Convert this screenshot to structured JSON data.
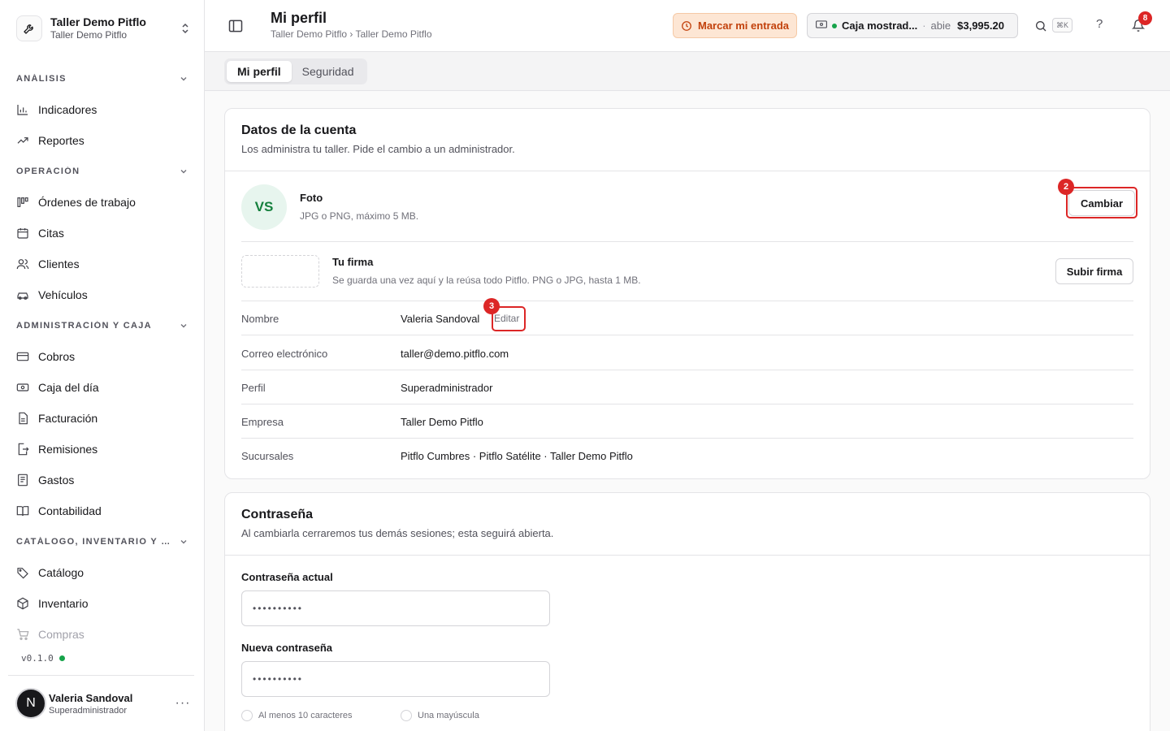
{
  "org": {
    "name": "Taller Demo Pitflo",
    "sub": "Taller Demo Pitflo"
  },
  "nav": {
    "analisis": {
      "label": "ANÁLISIS",
      "items": [
        "Indicadores",
        "Reportes"
      ]
    },
    "operacion": {
      "label": "OPERACIÓN",
      "items": [
        "Órdenes de trabajo",
        "Citas",
        "Clientes",
        "Vehículos"
      ]
    },
    "admin": {
      "label": "ADMINISTRACIÓN Y CAJA",
      "items": [
        "Cobros",
        "Caja del día",
        "Facturación",
        "Remisiones",
        "Gastos",
        "Contabilidad"
      ]
    },
    "catalogo": {
      "label": "CATÁLOGO, INVENTARIO Y CO...",
      "items": [
        "Catálogo",
        "Inventario",
        "Compras"
      ]
    }
  },
  "version": "v0.1.0",
  "user": {
    "initial": "N",
    "name": "Valeria Sandoval",
    "role": "Superadministrador",
    "more": "···"
  },
  "header": {
    "title": "Mi perfil",
    "breadcrumb": "Taller Demo Pitflo › Taller Demo Pitflo",
    "clock_in": "Marcar mi entrada",
    "cash_name": "Caja mostrad...",
    "cash_sep": "·",
    "cash_state": "abie",
    "cash_amount": "$3,995.20",
    "kbd": "⌘K",
    "help": "?",
    "notifications": "8"
  },
  "tabs": [
    "Mi perfil",
    "Seguridad"
  ],
  "account": {
    "title": "Datos de la cuenta",
    "desc": "Los administra tu taller. Pide el cambio a un administrador.",
    "photo_initials": "VS",
    "photo_title": "Foto",
    "photo_desc": "JPG o PNG, máximo 5 MB.",
    "photo_button": "Cambiar",
    "signature_title": "Tu firma",
    "signature_desc": "Se guarda una vez aquí y la reúsa todo Pitflo. PNG o JPG, hasta 1 MB.",
    "signature_button": "Subir firma",
    "edit_link": "Editar",
    "fields": [
      {
        "label": "Nombre",
        "value": "Valeria Sandoval"
      },
      {
        "label": "Correo electrónico",
        "value": "taller@demo.pitflo.com"
      },
      {
        "label": "Perfil",
        "value": "Superadministrador"
      },
      {
        "label": "Empresa",
        "value": "Taller Demo Pitflo"
      },
      {
        "label": "Sucursales",
        "value": "Pitflo Cumbres · Pitflo Satélite · Taller Demo Pitflo"
      }
    ]
  },
  "annotations": {
    "cambiar": "2",
    "editar": "3"
  },
  "password": {
    "title": "Contraseña",
    "desc": "Al cambiarla cerraremos tus demás sesiones; esta seguirá abierta.",
    "current_label": "Contraseña actual",
    "current_value": "••••••••••",
    "new_label": "Nueva contraseña",
    "new_value": "••••••••••",
    "rules": [
      "Al menos 10 caracteres",
      "Una mayúscula"
    ]
  },
  "colors": {
    "accent_orange": "#c2410c",
    "annotation_red": "#dc2626",
    "status_green": "#16a34a"
  }
}
